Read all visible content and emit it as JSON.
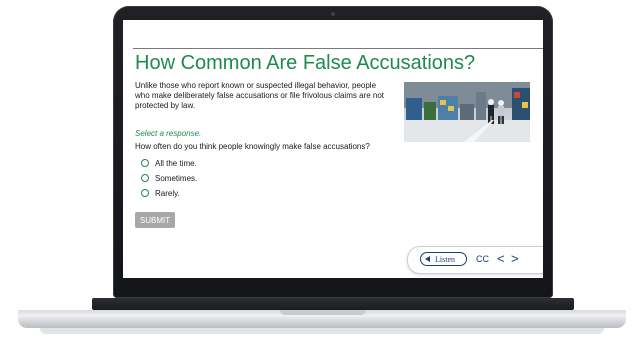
{
  "lesson": {
    "title": "How Common Are False Accusations?",
    "intro": "Unlike those who report known or suspected illegal behavior, people who make deliberately false accusations or file frivolous claims are not protected by law.",
    "instruction": "Select a response.",
    "question": "How often do you think people knowingly make false accusations?",
    "options": [
      "All the time.",
      "Sometimes.",
      "Rarely."
    ],
    "submit_label": "SUBMIT",
    "image_subject": "warehouse-workers-photo"
  },
  "player": {
    "listen_label": "Listen",
    "cc_label": "CC",
    "prev_symbol": "<",
    "next_symbol": ">"
  },
  "colors": {
    "accent_green": "#1f8a4c",
    "player_navy": "#1f3b78",
    "submit_gray": "#a7a7a7"
  }
}
